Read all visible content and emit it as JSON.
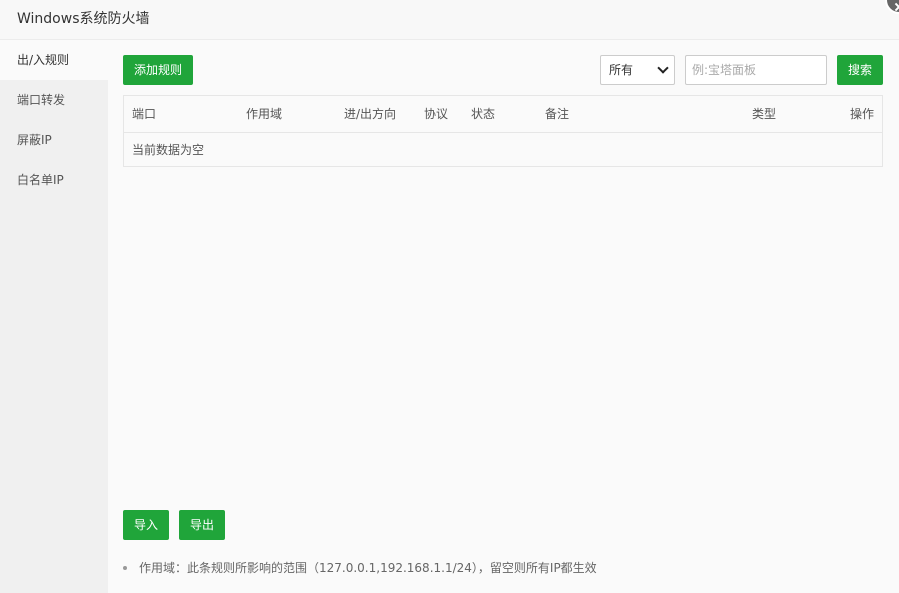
{
  "window": {
    "title": "Windows系统防火墙"
  },
  "sidebar": {
    "items": [
      {
        "label": "出/入规则"
      },
      {
        "label": "端口转发"
      },
      {
        "label": "屏蔽IP"
      },
      {
        "label": "白名单IP"
      }
    ]
  },
  "toolbar": {
    "add_label": "添加规则",
    "scope_selected": "所有",
    "search_placeholder": "例:宝塔面板",
    "search_label": "搜索"
  },
  "table": {
    "columns": [
      "端口",
      "作用域",
      "进/出方向",
      "协议",
      "状态",
      "备注",
      "类型",
      "操作"
    ],
    "empty_text": "当前数据为空"
  },
  "footer": {
    "import_label": "导入",
    "export_label": "导出",
    "tip": "作用域：此条规则所影响的范围（127.0.0.1,192.168.1.1/24），留空则所有IP都生效"
  },
  "colors": {
    "accent": "#20a53a"
  }
}
